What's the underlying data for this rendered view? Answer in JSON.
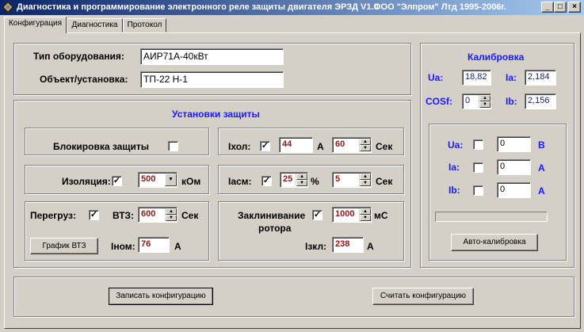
{
  "window": {
    "title": "Диагностика и программирование электронного реле защиты двигателя ЭРЗД   V1.0",
    "company": "ООО \"Элпром\" Лтд  1995-2006г.",
    "controls": {
      "minimize": "_",
      "maximize": "□",
      "close": "×"
    }
  },
  "tabs": [
    {
      "label": "Конфигурация",
      "active": true
    },
    {
      "label": "Диагностика",
      "active": false
    },
    {
      "label": "Протокол",
      "active": false
    }
  ],
  "equipment": {
    "type_label": "Тип оборудования:",
    "type_value": "АИР71А-40кВт",
    "object_label": "Объект/установка:",
    "object_value": "ТП-22 Н-1"
  },
  "protection": {
    "title": "Установки защиты",
    "block_label": "Блокировка защиты",
    "block_checked": false,
    "ixol_label": "Iхол:",
    "ixol_checked": true,
    "ixol_value": "44",
    "ixol_unit": "А",
    "ixol_time": "60",
    "ixol_time_unit": "Сек",
    "isolation_label": "Изоляция:",
    "isolation_checked": true,
    "isolation_value": "500",
    "isolation_unit": "кОм",
    "iasm_label": "Iасм:",
    "iasm_checked": true,
    "iasm_value": "25",
    "iasm_unit": "%",
    "iasm_time": "5",
    "iasm_time_unit": "Сек",
    "overload_label": "Перегруз:",
    "overload_checked": true,
    "vtz_label": "ВТЗ:",
    "vtz_value": "600",
    "vtz_unit": "Сек",
    "graph_button": "График ВТЗ",
    "inom_label": "Iном:",
    "inom_value": "76",
    "inom_unit": "А",
    "jam_label_line1": "Заклинивание",
    "jam_label_line2": "ротора",
    "jam_checked": true,
    "jam_value": "1000",
    "jam_unit": "мС",
    "izkl_label": "Iзкл:",
    "izkl_value": "238",
    "izkl_unit": "А"
  },
  "calibration": {
    "title": "Калибровка",
    "ua_label": "Ua:",
    "ua_value": "18,82",
    "ia_label": "Ia:",
    "ia_value": "2,184",
    "cosf_label": "COSf:",
    "cosf_value": "0",
    "ib_label": "Ib:",
    "ib_value": "2,156",
    "rows": [
      {
        "label": "Ua:",
        "value": "0",
        "unit": "В",
        "checked": false
      },
      {
        "label": "Ia:",
        "value": "0",
        "unit": "А",
        "checked": false
      },
      {
        "label": "Ib:",
        "value": "0",
        "unit": "А",
        "checked": false
      }
    ],
    "progress": 0,
    "auto_button": "Авто-калибровка"
  },
  "footer": {
    "write_button": "Записать конфигурацию",
    "read_button": "Считать конфигурацию"
  }
}
